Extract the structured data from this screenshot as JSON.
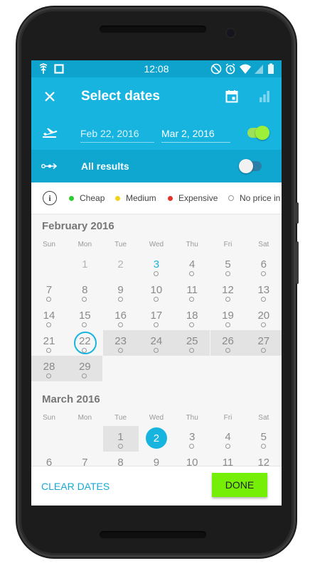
{
  "status": {
    "time": "12:08"
  },
  "appbar": {
    "title": "Select dates"
  },
  "dates": {
    "depart": "Feb 22, 2016",
    "return": "Mar 2, 2016"
  },
  "results": {
    "label": "All results"
  },
  "legend": {
    "info": "i",
    "items": [
      {
        "label": "Cheap",
        "color": "#2ecc2e"
      },
      {
        "label": "Medium",
        "color": "#f2d21b"
      },
      {
        "label": "Expensive",
        "color": "#e5322b"
      },
      {
        "label": "No price in",
        "color": "#ffffff"
      }
    ]
  },
  "calendar": {
    "weekdays": [
      "Sun",
      "Mon",
      "Tue",
      "Wed",
      "Thu",
      "Fri",
      "Sat"
    ],
    "feb": {
      "title": "February 2016",
      "weeks": [
        [
          "",
          "1",
          "2",
          "3",
          "4",
          "5",
          "6"
        ],
        [
          "7",
          "8",
          "9",
          "10",
          "11",
          "12",
          "13"
        ],
        [
          "14",
          "15",
          "16",
          "17",
          "18",
          "19",
          "20"
        ],
        [
          "21",
          "22",
          "23",
          "24",
          "25",
          "26",
          "27"
        ],
        [
          "28",
          "29",
          "",
          "",
          "",
          "",
          ""
        ]
      ]
    },
    "mar": {
      "title": "March 2016",
      "weeks": [
        [
          "",
          "",
          "1",
          "2",
          "3",
          "4",
          "5"
        ],
        [
          "6",
          "7",
          "8",
          "9",
          "10",
          "11",
          "12"
        ]
      ]
    }
  },
  "footer": {
    "clear": "CLEAR DATES",
    "done": "DONE"
  },
  "colors": {
    "primary": "#17b4e0",
    "primary_dark": "#0da3cc",
    "accent": "#76ef08"
  }
}
